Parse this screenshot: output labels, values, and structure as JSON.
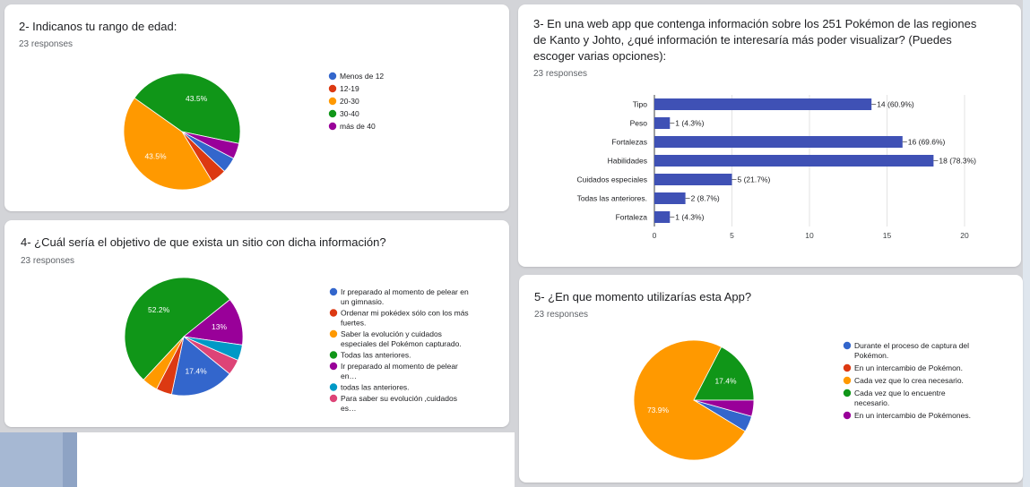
{
  "colors": {
    "blue": "#3366cc",
    "red": "#dc3912",
    "orange": "#ff9900",
    "green": "#109618",
    "purple": "#990099",
    "teal": "#0099c6",
    "pink": "#dd4477",
    "bar": "#3f51b5"
  },
  "cards": {
    "q2": {
      "title": "2- Indicanos tu rango de edad:",
      "responses": "23 responses"
    },
    "q3": {
      "title": "3- En una web app que contenga información sobre los 251 Pokémon de las regiones de Kanto y Johto, ¿qué información te interesaría más poder visualizar? (Puedes escoger varias opciones):",
      "responses": "23 responses"
    },
    "q4": {
      "title": "4- ¿Cuál sería el objetivo de que exista un sitio con dicha información?",
      "responses": "23 responses"
    },
    "q5": {
      "title": "5- ¿En que momento utilizarías esta App?",
      "responses": "23 responses"
    }
  },
  "chart_data": [
    {
      "id": "q2",
      "type": "pie",
      "slices": [
        {
          "label": "Menos de 12",
          "value": 4.35,
          "color": "#3366cc",
          "text": ""
        },
        {
          "label": "12-19",
          "value": 4.35,
          "color": "#dc3912",
          "text": ""
        },
        {
          "label": "20-30",
          "value": 43.5,
          "color": "#ff9900",
          "text": "43.5%"
        },
        {
          "label": "30-40",
          "value": 43.5,
          "color": "#109618",
          "text": "43.5%"
        },
        {
          "label": "más de 40",
          "value": 4.35,
          "color": "#990099",
          "text": ""
        }
      ],
      "legend": "right"
    },
    {
      "id": "q3",
      "type": "bar",
      "orientation": "horizontal",
      "categories": [
        "Tipo",
        "Peso",
        "Fortalezas",
        "Habilidades",
        "Cuidados especiales",
        "Todas las anteriores.",
        "Fortaleza"
      ],
      "values": [
        14,
        1,
        16,
        18,
        5,
        2,
        1
      ],
      "labels": [
        "14 (60.9%)",
        "1 (4.3%)",
        "16 (69.6%)",
        "18 (78.3%)",
        "5 (21.7%)",
        "2 (8.7%)",
        "1 (4.3%)"
      ],
      "xlim": [
        0,
        20
      ],
      "xticks": [
        "0",
        "5",
        "10",
        "15",
        "20"
      ],
      "grid": true
    },
    {
      "id": "q4",
      "type": "pie",
      "slices": [
        {
          "label": "Ir preparado al momento de pelear en un gimnasio.",
          "value": 17.4,
          "color": "#3366cc",
          "text": "17.4%"
        },
        {
          "label": "Ordenar mi pokédex sólo con los más fuertes.",
          "value": 4.3,
          "color": "#dc3912",
          "text": ""
        },
        {
          "label": "Saber la evolución y cuidados especiales del Pokémon capturado.",
          "value": 4.3,
          "color": "#ff9900",
          "text": ""
        },
        {
          "label": "Todas las anteriores.",
          "value": 52.2,
          "color": "#109618",
          "text": "52.2%"
        },
        {
          "label": "Ir preparado al momento de pelear en…",
          "value": 13.0,
          "color": "#990099",
          "text": "13%"
        },
        {
          "label": "todas las anteriores.",
          "value": 4.3,
          "color": "#0099c6",
          "text": ""
        },
        {
          "label": "Para saber su evolución ,cuidados es…",
          "value": 4.3,
          "color": "#dd4477",
          "text": ""
        }
      ],
      "legend": "right"
    },
    {
      "id": "q5",
      "type": "pie",
      "slices": [
        {
          "label": "Durante el proceso de captura del Pokémon.",
          "value": 4.35,
          "color": "#3366cc",
          "text": ""
        },
        {
          "label": "En un intercambio de Pokémon.",
          "value": 0,
          "color": "#dc3912",
          "text": ""
        },
        {
          "label": "Cada vez que lo crea necesario.",
          "value": 73.9,
          "color": "#ff9900",
          "text": "73.9%"
        },
        {
          "label": "Cada vez que lo encuentre necesario.",
          "value": 17.4,
          "color": "#109618",
          "text": "17.4%"
        },
        {
          "label": "En un intercambio de Pokémones.",
          "value": 4.35,
          "color": "#990099",
          "text": ""
        }
      ],
      "legend": "right"
    }
  ]
}
